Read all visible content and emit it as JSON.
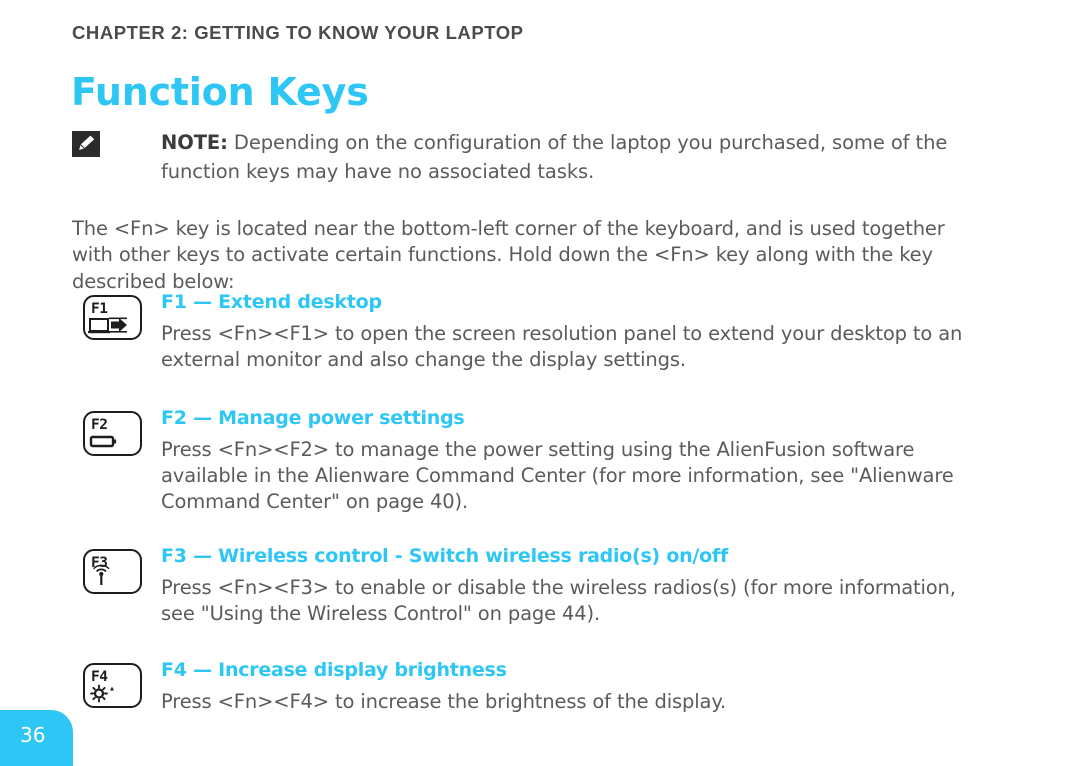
{
  "chapter": {
    "header": "CHAPTER 2: GETTING TO KNOW YOUR LAPTOP"
  },
  "title": "Function Keys",
  "note": {
    "icon": "note-pencil-icon",
    "label": "NOTE:",
    "text": " Depending on the configuration of the laptop you purchased, some of the function keys may have no associated tasks."
  },
  "intro": "The <Fn> key is located near the bottom-left corner of the keyboard, and is used together with other keys to activate certain functions. Hold down the <Fn> key along with the key described below:",
  "function_keys": [
    {
      "key_label": "F1",
      "key_icon": "extend-desktop-icon",
      "heading": "F1 — Extend desktop",
      "body": "Press <Fn><F1> to open the screen resolution panel to extend your desktop to an external monitor and also change the display settings."
    },
    {
      "key_label": "F2",
      "key_icon": "battery-icon",
      "heading": "F2 — Manage power settings",
      "body": "Press <Fn><F2> to manage the power setting using the AlienFusion software available in the Alienware Command Center (for more information, see \"Alienware Command Center\" on page 40)."
    },
    {
      "key_label": "F3",
      "key_icon": "wireless-antenna-icon",
      "heading": "F3 — Wireless control - Switch wireless radio(s) on/off",
      "body": "Press <Fn><F3> to enable or disable the wireless radios(s) (for more information, see \"Using the Wireless Control\" on page 44)."
    },
    {
      "key_label": "F4",
      "key_icon": "brightness-up-icon",
      "heading": "F4 — Increase display brightness",
      "body": "Press <Fn><F4> to increase the brightness of the display."
    }
  ],
  "page_number": "36",
  "colors": {
    "accent": "#2ec6f5",
    "body_text": "#5b5b5b",
    "header_text": "#4b4b4b",
    "key_outline": "#1d1d1d",
    "note_icon_bg": "#2b2b2b"
  }
}
